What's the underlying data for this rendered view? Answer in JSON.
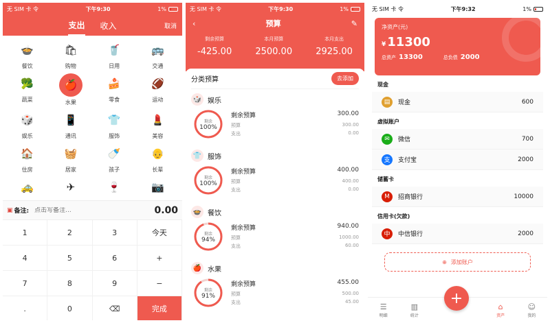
{
  "status": {
    "p1": {
      "left": "无 SIM 卡 令",
      "time": "下午9:30",
      "battery": "1%"
    },
    "p2": {
      "left": "无 SIM 卡 令",
      "time": "下午9:30",
      "battery": "1%"
    },
    "p3": {
      "left": "无 SIM 卡 令",
      "time": "下午9:32",
      "battery": "1%"
    }
  },
  "entry": {
    "tabs": [
      "支出",
      "收入"
    ],
    "cancel": "取消",
    "categories": [
      {
        "label": "餐饮",
        "icon": "🍲"
      },
      {
        "label": "购物",
        "icon": "🛍"
      },
      {
        "label": "日用",
        "icon": "🥤"
      },
      {
        "label": "交通",
        "icon": "🚌"
      },
      {
        "label": "蔬菜",
        "icon": "🥦"
      },
      {
        "label": "水果",
        "icon": "🍎"
      },
      {
        "label": "零食",
        "icon": "🍰"
      },
      {
        "label": "运动",
        "icon": "🏈"
      },
      {
        "label": "娱乐",
        "icon": "🎲"
      },
      {
        "label": "通讯",
        "icon": "📱"
      },
      {
        "label": "服饰",
        "icon": "👕"
      },
      {
        "label": "美容",
        "icon": "💄"
      },
      {
        "label": "住房",
        "icon": "🏠"
      },
      {
        "label": "居家",
        "icon": "🧺"
      },
      {
        "label": "孩子",
        "icon": "🍼"
      },
      {
        "label": "长辈",
        "icon": "👴"
      },
      {
        "label": "",
        "icon": "🚕"
      },
      {
        "label": "",
        "icon": "✈"
      },
      {
        "label": "",
        "icon": "🍷"
      },
      {
        "label": "",
        "icon": "📷"
      }
    ],
    "selected": "水果",
    "memo_label": "备注:",
    "memo_placeholder": "点击写备注...",
    "amount": "0.00",
    "keys": [
      "1",
      "2",
      "3",
      "今天",
      "4",
      "5",
      "6",
      "+",
      "7",
      "8",
      "9",
      "−",
      ".",
      "0",
      "⌫",
      "完成"
    ]
  },
  "budget": {
    "title": "预算",
    "summary": [
      {
        "label": "剩余预算",
        "value": "-425.00"
      },
      {
        "label": "本月预算",
        "value": "2500.00"
      },
      {
        "label": "本月支出",
        "value": "2925.00"
      }
    ],
    "section_title": "分类预算",
    "add_button": "去添加",
    "items": [
      {
        "name": "娱乐",
        "icon": "🎲",
        "ring_label": "剩余",
        "pct": "100%",
        "pct_value": 100,
        "remain_label": "剩余预算",
        "remain": "300.00",
        "budget_label": "预算",
        "budget": "300.00",
        "spent_label": "支出",
        "spent": "0.00"
      },
      {
        "name": "服饰",
        "icon": "👕",
        "ring_label": "剩余",
        "pct": "100%",
        "pct_value": 100,
        "remain_label": "剩余预算",
        "remain": "400.00",
        "budget_label": "预算",
        "budget": "400.00",
        "spent_label": "支出",
        "spent": "0.00"
      },
      {
        "name": "餐饮",
        "icon": "🍲",
        "ring_label": "剩余",
        "pct": "94%",
        "pct_value": 94,
        "remain_label": "剩余预算",
        "remain": "940.00",
        "budget_label": "预算",
        "budget": "1000.00",
        "spent_label": "支出",
        "spent": "60.00"
      },
      {
        "name": "水果",
        "icon": "🍎",
        "ring_label": "剩余",
        "pct": "91%",
        "pct_value": 91,
        "remain_label": "剩余预算",
        "remain": "455.00",
        "budget_label": "预算",
        "budget": "500.00",
        "spent_label": "支出",
        "spent": "45.00"
      }
    ]
  },
  "assets": {
    "net_label": "净资产(元)",
    "currency": "¥",
    "net_value": "11300",
    "total_assets_label": "总资产",
    "total_assets": "13300",
    "total_debt_label": "总负债",
    "total_debt": "2000",
    "groups": [
      {
        "name": "现金",
        "accounts": [
          {
            "name": "现金",
            "value": "600",
            "icon": "▤",
            "color": "#e0a030"
          }
        ]
      },
      {
        "name": "虚拟账户",
        "accounts": [
          {
            "name": "微信",
            "value": "700",
            "icon": "✉",
            "color": "#1aad19"
          },
          {
            "name": "支付宝",
            "value": "2000",
            "icon": "支",
            "color": "#1677ff"
          }
        ]
      },
      {
        "name": "储蓄卡",
        "accounts": [
          {
            "name": "招商银行",
            "value": "10000",
            "icon": "M",
            "color": "#d81e06"
          }
        ]
      },
      {
        "name": "信用卡(欠款)",
        "accounts": [
          {
            "name": "中信银行",
            "value": "2000",
            "icon": "中",
            "color": "#d81e06"
          }
        ]
      }
    ],
    "add_account": "添加账户",
    "tabs": [
      {
        "label": "明细",
        "icon": "☰"
      },
      {
        "label": "统计",
        "icon": "▥"
      },
      {
        "label": "资产",
        "icon": "⌂"
      },
      {
        "label": "我的",
        "icon": "☺"
      }
    ],
    "active_tab": "资产"
  },
  "colors": {
    "accent": "#ef5a4f"
  }
}
